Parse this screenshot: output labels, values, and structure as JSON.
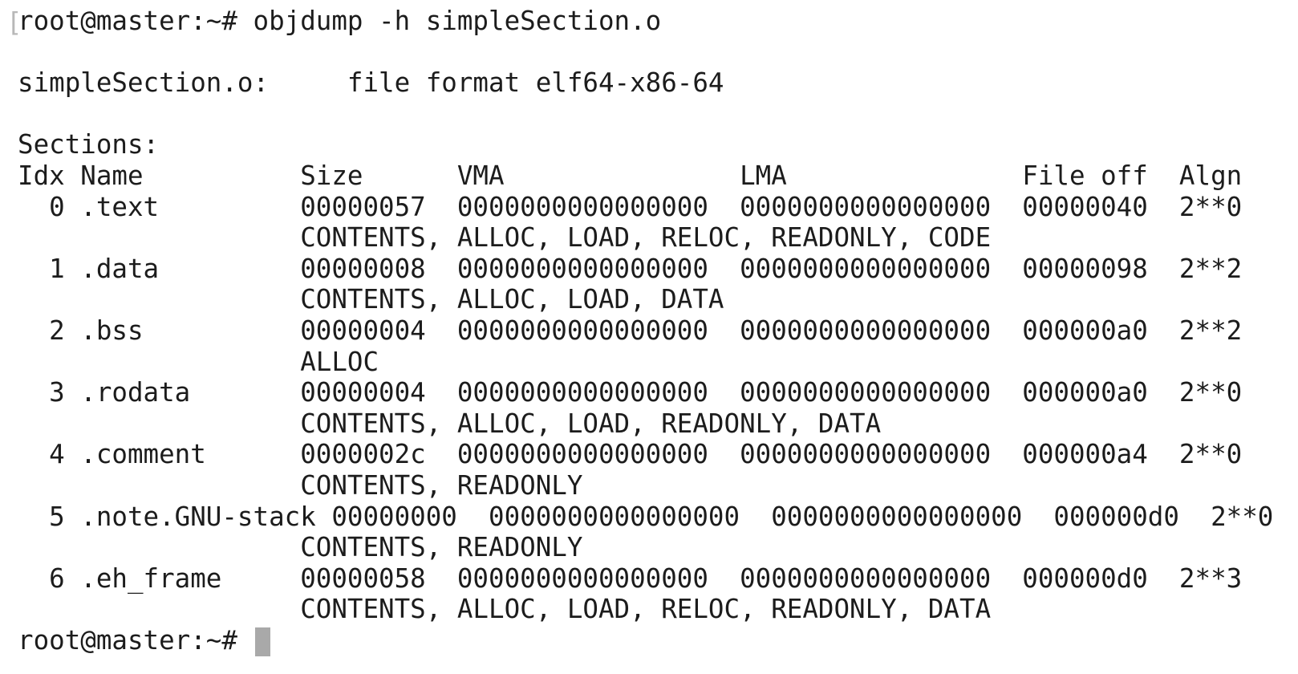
{
  "terminal": {
    "command_line": "root@master:~# objdump -h simpleSection.o",
    "file_format_line": "simpleSection.o:     file format elf64-x86-64",
    "sections_label": "Sections:",
    "header_line": "Idx Name          Size      VMA               LMA               File off  Algn",
    "section_lines": [
      "  0 .text         00000057  0000000000000000  0000000000000000  00000040  2**0",
      "                  CONTENTS, ALLOC, LOAD, RELOC, READONLY, CODE",
      "  1 .data         00000008  0000000000000000  0000000000000000  00000098  2**2",
      "                  CONTENTS, ALLOC, LOAD, DATA",
      "  2 .bss          00000004  0000000000000000  0000000000000000  000000a0  2**2",
      "                  ALLOC",
      "  3 .rodata       00000004  0000000000000000  0000000000000000  000000a0  2**0",
      "                  CONTENTS, ALLOC, LOAD, READONLY, DATA",
      "  4 .comment      0000002c  0000000000000000  0000000000000000  000000a4  2**0",
      "                  CONTENTS, READONLY",
      "  5 .note.GNU-stack 00000000  0000000000000000  0000000000000000  000000d0  2**0",
      "                  CONTENTS, READONLY",
      "  6 .eh_frame     00000058  0000000000000000  0000000000000000  000000d0  2**3",
      "                  CONTENTS, ALLOC, LOAD, RELOC, READONLY, DATA"
    ],
    "prompt": "root@master:~# "
  }
}
